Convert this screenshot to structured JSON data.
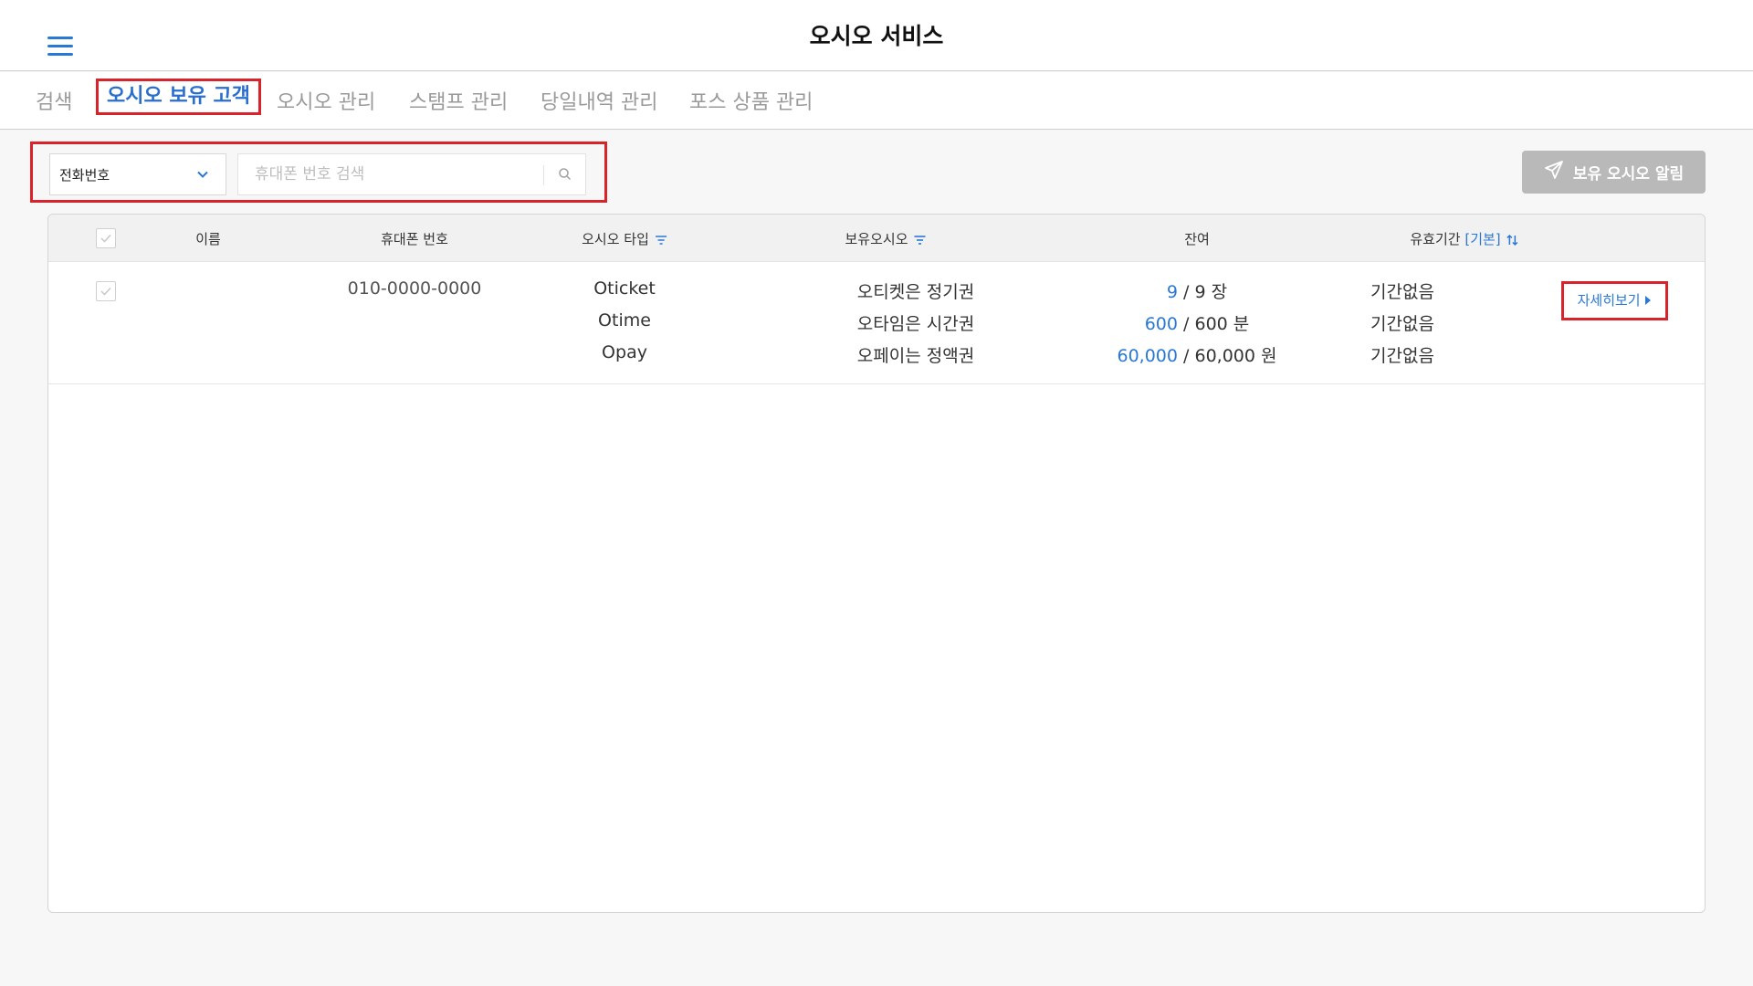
{
  "header": {
    "title": "오시오 서비스",
    "menu_icon": "hamburger-menu-icon"
  },
  "tabs": [
    {
      "label": "검색",
      "active": false
    },
    {
      "label": "오시오 보유 고객",
      "active": true
    },
    {
      "label": "오시오 관리",
      "active": false
    },
    {
      "label": "스탬프 관리",
      "active": false
    },
    {
      "label": "당일내역 관리",
      "active": false
    },
    {
      "label": "포스 상품 관리",
      "active": false
    }
  ],
  "search": {
    "select_value": "전화번호",
    "input_value": "",
    "placeholder": "휴대폰 번호 검색"
  },
  "notify_button": {
    "label": "보유 오시오 알림",
    "icon": "send-icon"
  },
  "table": {
    "columns": {
      "name": "이름",
      "phone": "휴대폰 번호",
      "type": "오시오 타입",
      "holding": "보유오시오",
      "balance": "잔여",
      "expiry_label": "유효기간",
      "expiry_mode": "[기본]"
    },
    "row": {
      "name": "",
      "phone": "010-0000-0000",
      "items": [
        {
          "type": "Oticket",
          "holding": "오티켓은 정기권",
          "remaining": "9",
          "total": "9",
          "unit": "장",
          "expiry": "기간없음"
        },
        {
          "type": "Otime",
          "holding": "오타임은 시간권",
          "remaining": "600",
          "total": "600",
          "unit": "분",
          "expiry": "기간없음"
        },
        {
          "type": "Opay",
          "holding": "오페이는 정액권",
          "remaining": "60,000",
          "total": "60,000",
          "unit": "원",
          "expiry": "기간없음"
        }
      ],
      "detail_label": "자세히보기"
    },
    "separator": "/"
  },
  "colors": {
    "accent": "#2a78d6",
    "highlight_border": "#d9232a",
    "disabled_button": "#b9b9b9"
  }
}
